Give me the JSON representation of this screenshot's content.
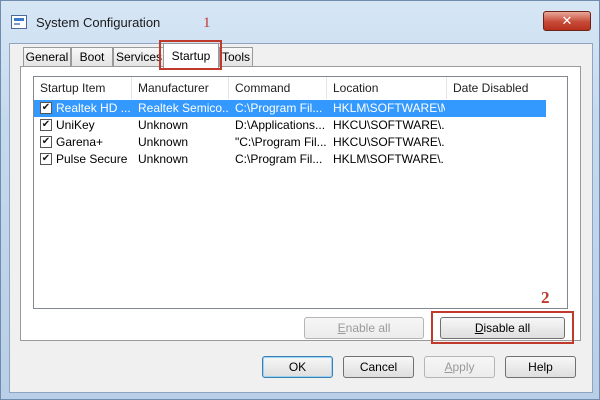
{
  "window": {
    "title": "System Configuration",
    "close_symbol": "✕"
  },
  "tabs": [
    {
      "label": "General"
    },
    {
      "label": "Boot"
    },
    {
      "label": "Services"
    },
    {
      "label": "Startup"
    },
    {
      "label": "Tools"
    }
  ],
  "active_tab": "Startup",
  "annotations": {
    "step1": "1",
    "step2": "2"
  },
  "colors": {
    "annotation": "#c0392b",
    "selection": "#3399ff"
  },
  "table": {
    "columns": [
      "Startup Item",
      "Manufacturer",
      "Command",
      "Location",
      "Date Disabled"
    ],
    "rows": [
      {
        "checked": true,
        "selected": true,
        "item": "Realtek HD ...",
        "manufacturer": "Realtek Semico...",
        "command": "C:\\Program Fil...",
        "location": "HKLM\\SOFTWARE\\M...",
        "date_disabled": ""
      },
      {
        "checked": true,
        "selected": false,
        "item": "UniKey",
        "manufacturer": "Unknown",
        "command": "D:\\Applications...",
        "location": "HKCU\\SOFTWARE\\...",
        "date_disabled": ""
      },
      {
        "checked": true,
        "selected": false,
        "item": "Garena+",
        "manufacturer": "Unknown",
        "command": "\"C:\\Program Fil...",
        "location": "HKCU\\SOFTWARE\\...",
        "date_disabled": ""
      },
      {
        "checked": true,
        "selected": false,
        "item": "Pulse Secure",
        "manufacturer": "Unknown",
        "command": "C:\\Program Fil...",
        "location": "HKLM\\SOFTWARE\\...",
        "date_disabled": ""
      }
    ]
  },
  "buttons": {
    "enable_all": {
      "label": "Enable all",
      "mnemonic": "E",
      "rest": "nable all"
    },
    "disable_all": {
      "label": "Disable all",
      "mnemonic": "D",
      "rest": "isable all"
    },
    "ok": "OK",
    "cancel": "Cancel",
    "apply": {
      "label": "Apply",
      "mnemonic": "A",
      "rest": "pply"
    },
    "help": "Help"
  }
}
